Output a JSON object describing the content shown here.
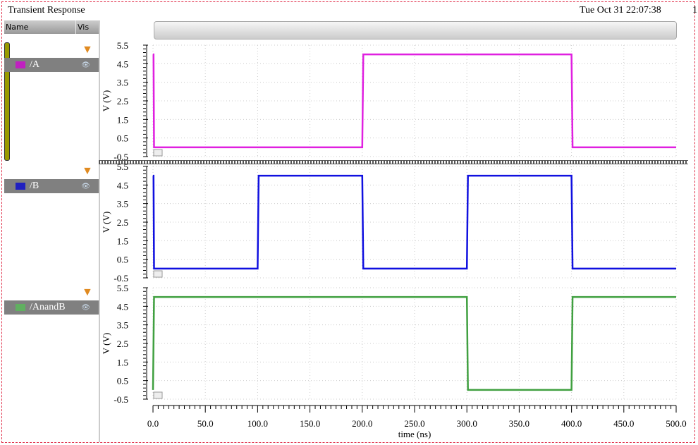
{
  "window": {
    "title": "Transient Response",
    "timestamp": "Tue Oct 31 22:07:38",
    "corner": "1"
  },
  "sidebar": {
    "col_name": "Name",
    "col_vis": "Vis",
    "signals": [
      {
        "label": "/A",
        "color": "#c020c0"
      },
      {
        "label": "/B",
        "color": "#2020c0"
      },
      {
        "label": "/AnandB",
        "color": "#60b060"
      }
    ]
  },
  "colors": {
    "A": "#e020e0",
    "B": "#1010e0",
    "AnandB": "#40a040"
  },
  "chart_data": {
    "type": "line",
    "xlabel": "time (ns)",
    "ylabel": "V (V)",
    "xlim": [
      0,
      500
    ],
    "ylim": [
      -0.5,
      5.5
    ],
    "xticks": [
      "0.0",
      "50.0",
      "100.0",
      "150.0",
      "200.0",
      "250.0",
      "300.0",
      "350.0",
      "400.0",
      "450.0",
      "500.0"
    ],
    "yticks": [
      "5.5",
      "4.5",
      "3.5",
      "2.5",
      "1.5",
      "0.5",
      "-0.5"
    ],
    "series": [
      {
        "name": "/A",
        "x": [
          0,
          0.5,
          1,
          200,
          201,
          400,
          401,
          500
        ],
        "y": [
          5,
          5,
          0,
          0,
          5,
          5,
          0,
          0
        ]
      },
      {
        "name": "/B",
        "x": [
          0,
          0.5,
          1,
          100,
          101,
          200,
          201,
          300,
          301,
          400,
          401,
          500
        ],
        "y": [
          5,
          5,
          0,
          0,
          5,
          5,
          0,
          0,
          5,
          5,
          0,
          0
        ]
      },
      {
        "name": "/AnandB",
        "x": [
          0,
          1,
          300,
          301,
          400,
          401,
          500
        ],
        "y": [
          0,
          5,
          5,
          0,
          0,
          5,
          5
        ]
      }
    ]
  }
}
